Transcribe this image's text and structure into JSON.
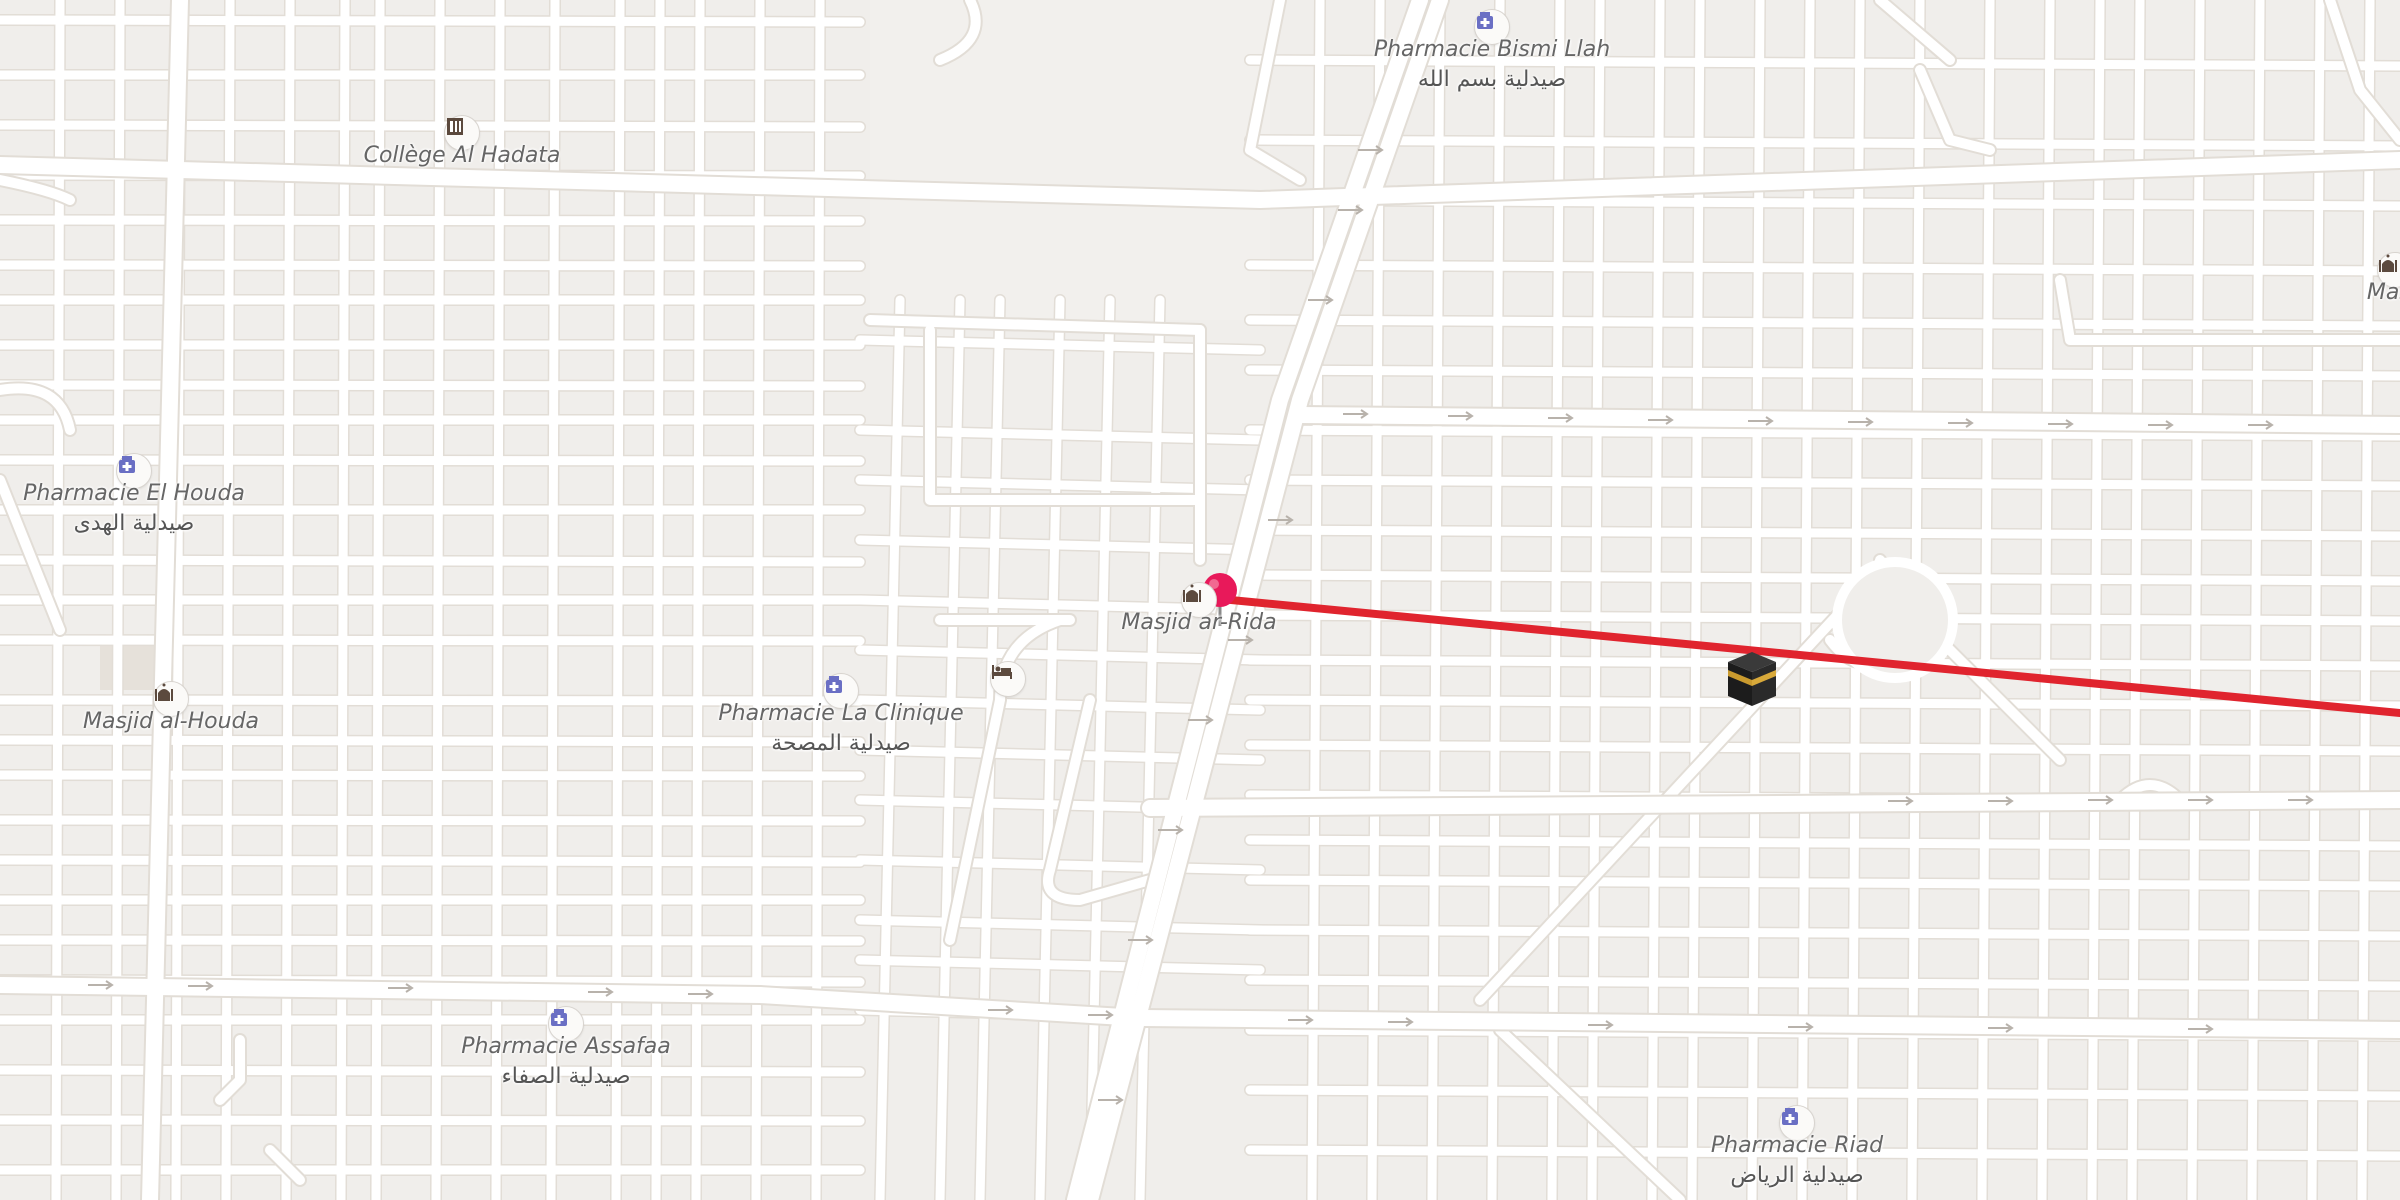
{
  "map": {
    "pois": [
      {
        "id": "pharmacie-bismi-llah",
        "icon": "pharmacy-icon",
        "name": "Pharmacie Bismi Llah",
        "name_ar": "صيدلية بسم الله"
      },
      {
        "id": "college-al-hadata",
        "icon": "school-icon",
        "name": "Collège Al Hadata",
        "name_ar": ""
      },
      {
        "id": "pharmacie-el-houda",
        "icon": "pharmacy-icon",
        "name": "Pharmacie El Houda",
        "name_ar": "صيدلية الهدى"
      },
      {
        "id": "masjid-al-houda",
        "icon": "mosque-icon",
        "name": "Masjid al-Houda",
        "name_ar": ""
      },
      {
        "id": "masjid-ar-rida",
        "icon": "mosque-icon",
        "name": "Masjid ar-Rida",
        "name_ar": ""
      },
      {
        "id": "pharmacie-la-clinique",
        "icon": "pharmacy-icon",
        "name": "Pharmacie La Clinique",
        "name_ar": "صيدلية المصحة"
      },
      {
        "id": "hotel",
        "icon": "bed-icon",
        "name": "",
        "name_ar": ""
      },
      {
        "id": "pharmacie-assafaa",
        "icon": "pharmacy-icon",
        "name": "Pharmacie Assafaa",
        "name_ar": "صيدلية الصفاء"
      },
      {
        "id": "pharmacie-riad",
        "icon": "pharmacy-icon",
        "name": "Pharmacie Riad",
        "name_ar": "صيدلية الرياض"
      },
      {
        "id": "masjid-edge",
        "icon": "mosque-icon",
        "name": "Masji",
        "name_ar": ""
      }
    ],
    "markers": {
      "location_pin": {
        "icon": "location-pin-icon",
        "color": "#e8195a"
      },
      "qibla_target": {
        "icon": "kaaba-icon"
      }
    },
    "qibla_line": {
      "color": "#e0242e"
    }
  }
}
